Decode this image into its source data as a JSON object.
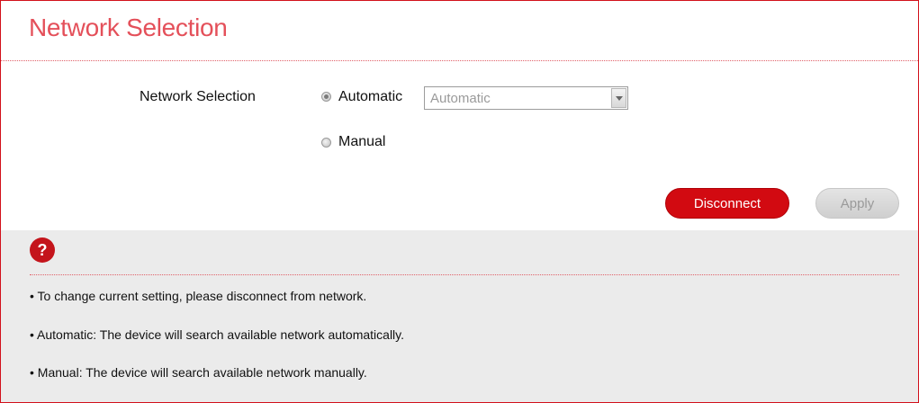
{
  "page": {
    "title": "Network Selection"
  },
  "form": {
    "field_label": "Network Selection",
    "options": [
      {
        "label": "Automatic",
        "checked": true
      },
      {
        "label": "Manual",
        "checked": false
      }
    ],
    "select": {
      "value": "Automatic",
      "disabled": true
    }
  },
  "buttons": {
    "disconnect": "Disconnect",
    "apply": "Apply"
  },
  "help": {
    "icon": "?",
    "notes": [
      "• To change current setting, please disconnect from network.",
      "• Automatic: The device will search available network automatically.",
      "• Manual: The device will search available network manually."
    ]
  },
  "colors": {
    "accent": "#d20a11",
    "title": "#e4505a",
    "help_bg": "#ebebeb"
  }
}
